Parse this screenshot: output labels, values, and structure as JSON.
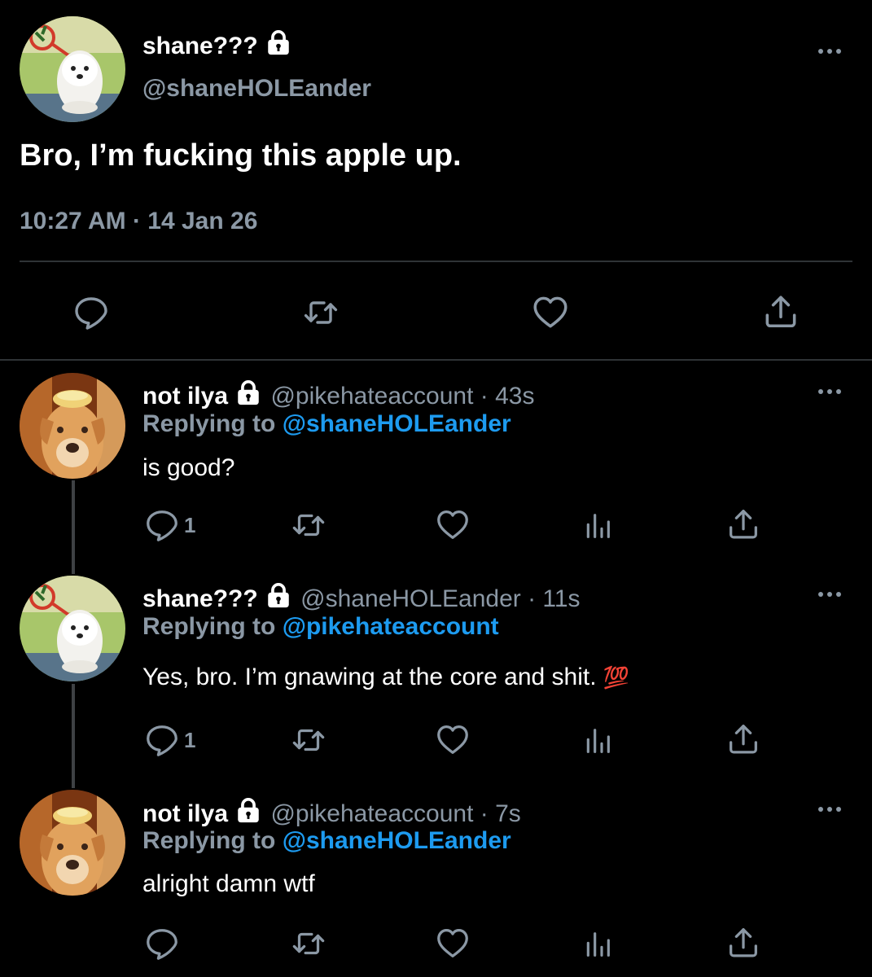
{
  "main_tweet": {
    "display_name": "shane???",
    "handle": "@shaneHOLEander",
    "text": "Bro, I’m fucking this apple up.",
    "time": "10:27 AM",
    "separator": "·",
    "date": "14 Jan 26"
  },
  "replies": [
    {
      "display_name": "not ilya",
      "handle_time": "@pikehateaccount · 43s",
      "replying_prefix": "Replying to",
      "replying_to": "@shaneHOLEander",
      "text": "is good?",
      "reply_count": "1"
    },
    {
      "display_name": "shane???",
      "handle_time": "@shaneHOLEander · 11s",
      "replying_prefix": "Replying to",
      "replying_to": "@pikehateaccount",
      "text": "Yes, bro. I’m gnawing at the core and shit.",
      "emoji": "💯",
      "reply_count": "1"
    },
    {
      "display_name": "not ilya",
      "handle_time": "@pikehateaccount · 7s",
      "replying_prefix": "Replying to",
      "replying_to": "@shaneHOLEander",
      "text": "alright damn wtf",
      "reply_count": ""
    }
  ],
  "colors": {
    "background": "#000000",
    "text": "#ffffff",
    "secondary": "#8b98a5",
    "accent": "#1d9bf0",
    "divider": "#2f3336"
  },
  "icons": [
    "lock-icon",
    "more-icon",
    "reply-icon",
    "retweet-icon",
    "like-icon",
    "share-icon",
    "analytics-icon"
  ]
}
